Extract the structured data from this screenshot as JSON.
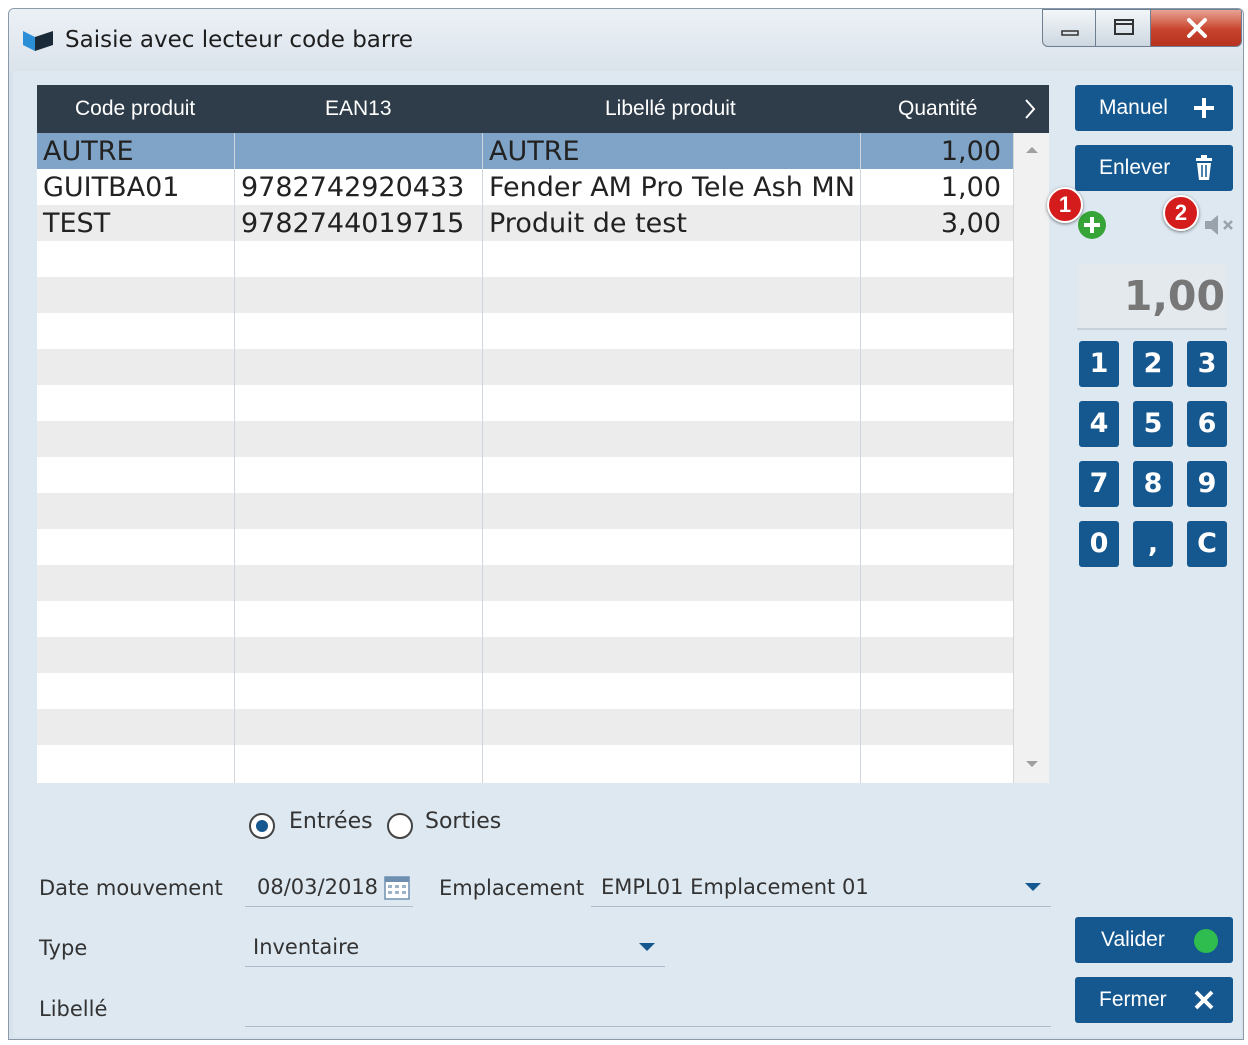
{
  "window": {
    "title": "Saisie avec lecteur code barre"
  },
  "grid": {
    "columns": [
      "Code produit",
      "EAN13",
      "Libellé produit",
      "Quantité"
    ],
    "rows": [
      {
        "code": "AUTRE",
        "ean": "",
        "libelle": "AUTRE",
        "quantite": "1,00"
      },
      {
        "code": "GUITBA01",
        "ean": "9782742920433",
        "libelle": "Fender AM Pro Tele Ash MN",
        "quantite": "1,00"
      },
      {
        "code": "TEST",
        "ean": "9782744019715",
        "libelle": "Produit de test",
        "quantite": "3,00"
      }
    ]
  },
  "buttons": {
    "manuel": "Manuel",
    "enlever": "Enlever",
    "valider": "Valider",
    "fermer": "Fermer"
  },
  "badges": {
    "one": "1",
    "two": "2"
  },
  "display": {
    "value": "1,00"
  },
  "keypad": [
    "1",
    "2",
    "3",
    "4",
    "5",
    "6",
    "7",
    "8",
    "9",
    "0",
    ",",
    "C"
  ],
  "direction": {
    "entrees": "Entrées",
    "sorties": "Sorties",
    "selected": "Entrées"
  },
  "form": {
    "date_label": "Date mouvement",
    "date_value": "08/03/2018",
    "emplacement_label": "Emplacement",
    "emplacement_value": "EMPL01 Emplacement 01",
    "type_label": "Type",
    "type_value": "Inventaire",
    "libelle_label": "Libellé",
    "libelle_value": ""
  },
  "colors": {
    "accent": "#14588f",
    "header": "#2f3d4a",
    "selected_row": "#7fa4c7",
    "status_ok": "#2ebd4e",
    "badge": "#d41c1c"
  }
}
